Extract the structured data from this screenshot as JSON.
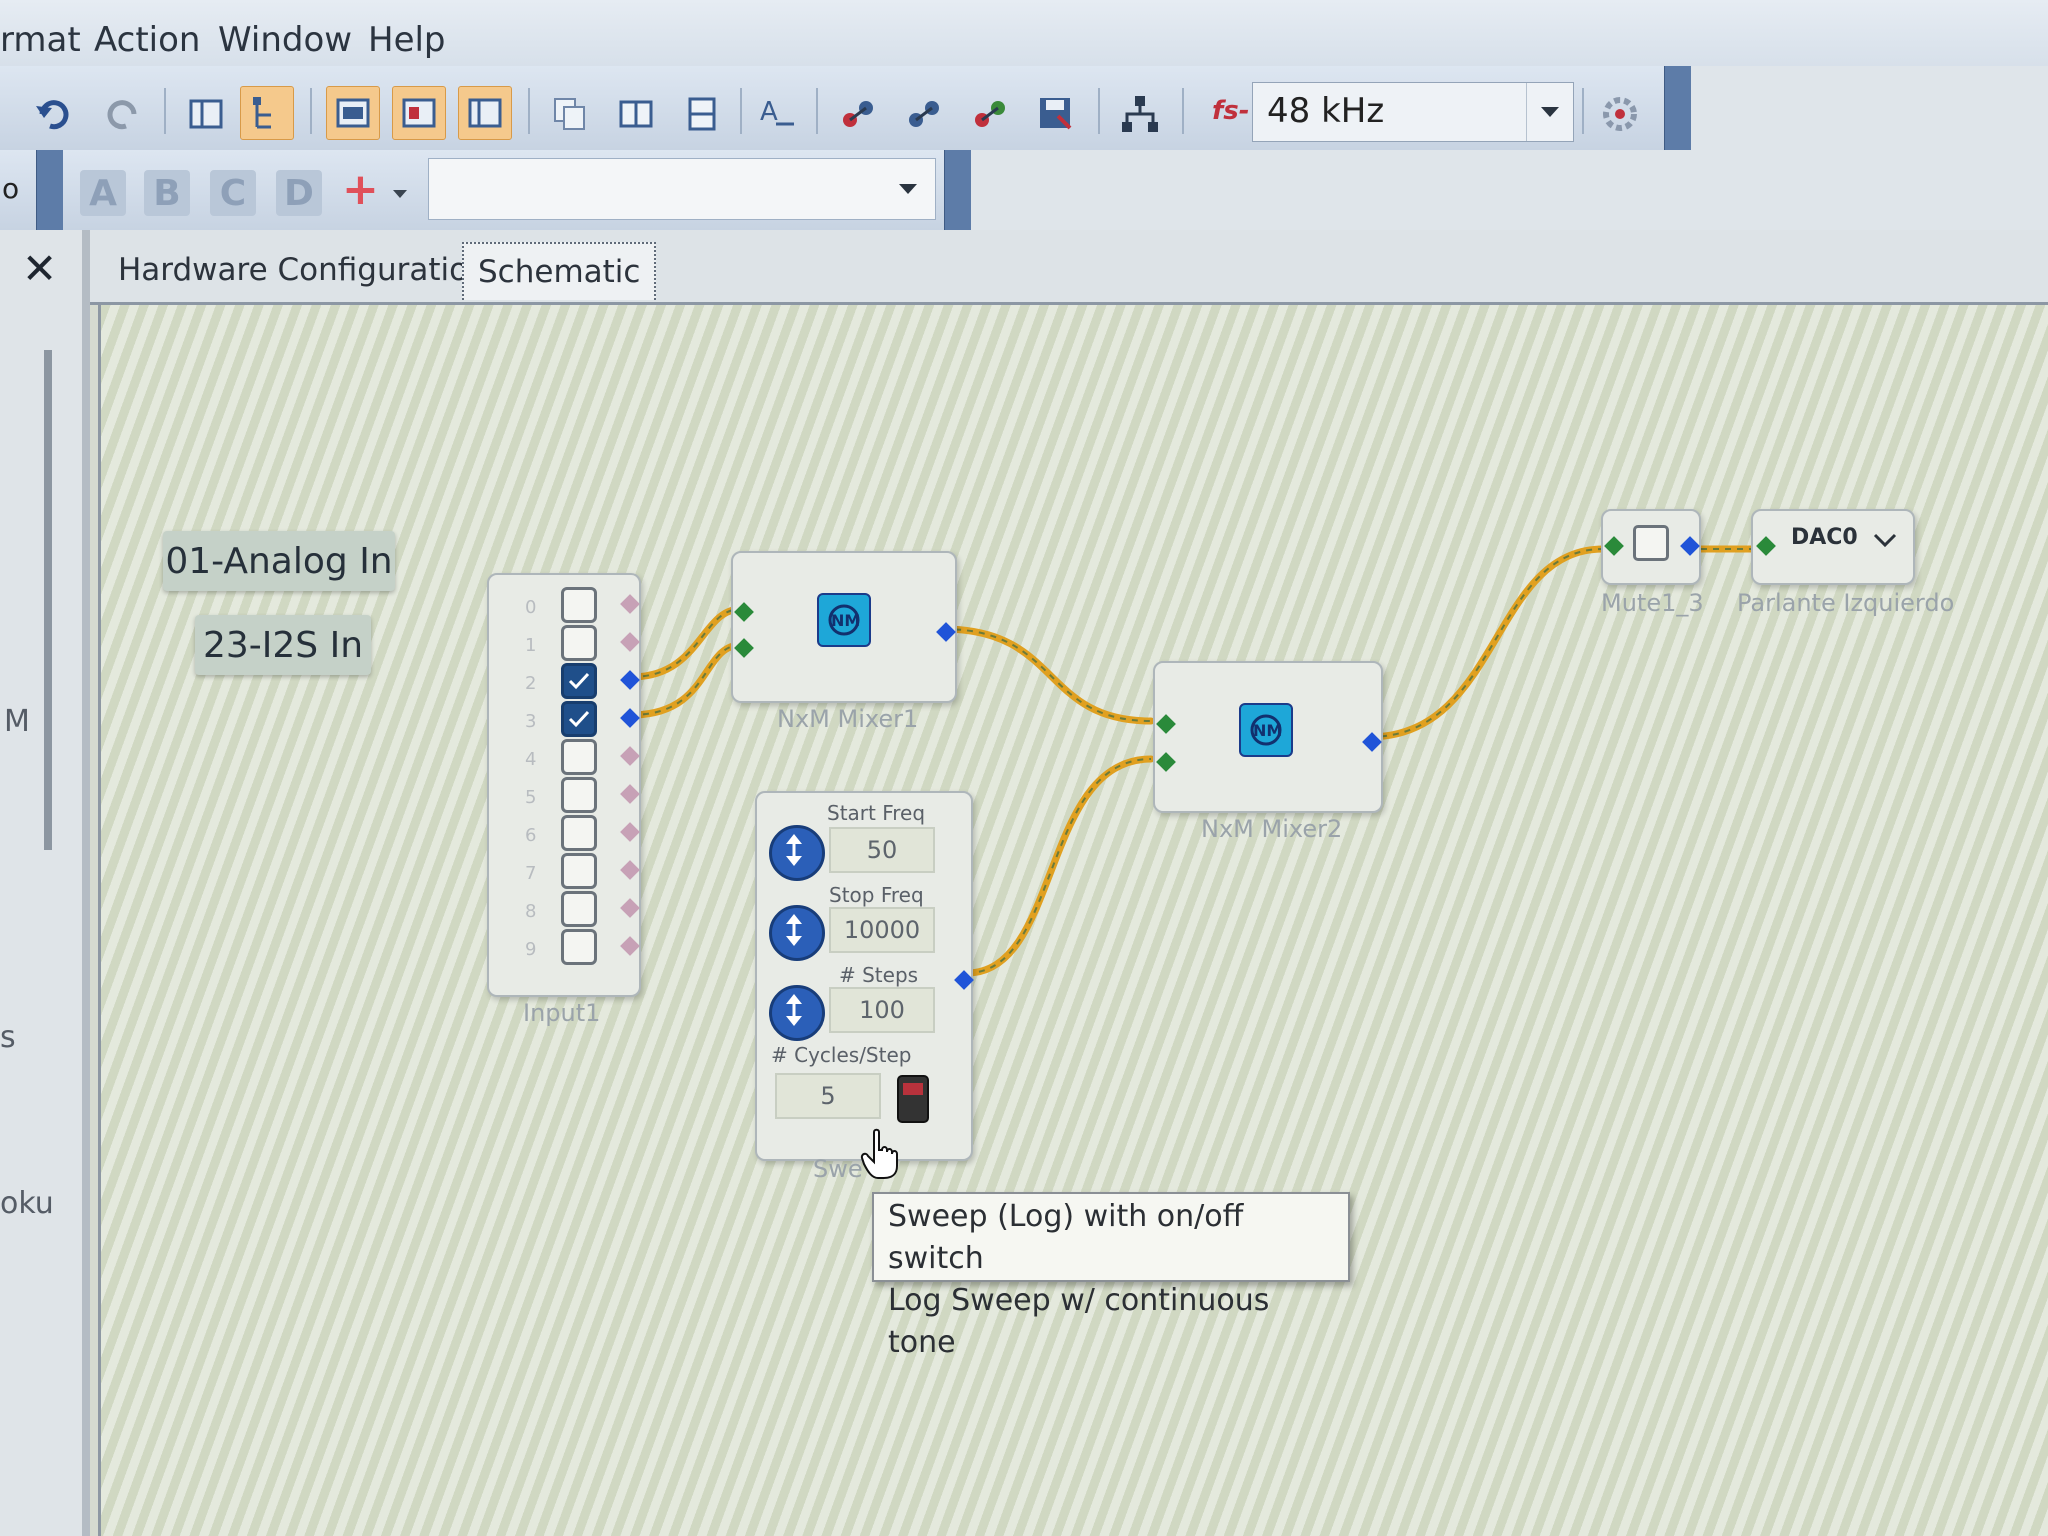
{
  "menu": {
    "items": [
      "rmat",
      "Action",
      "Window",
      "Help"
    ]
  },
  "toolbar": {
    "sample_rate_prefix": "fs-",
    "sample_rate": "48 kHz",
    "letter_buttons": [
      "A",
      "B",
      "C",
      "D"
    ],
    "add_symbol": "+",
    "left_stub": "o"
  },
  "tabs": [
    {
      "label": "Hardware Configuration",
      "active": false
    },
    {
      "label": "Schematic",
      "active": true
    }
  ],
  "side_panel": {
    "close": "✕",
    "fragments": [
      "M",
      "s",
      "oku"
    ]
  },
  "schematic": {
    "labels": {
      "analog_in": "01-Analog In",
      "i2s_in": "23-I2S In"
    },
    "input": {
      "caption": "Input1",
      "channels": [
        {
          "num": "0",
          "checked": false
        },
        {
          "num": "1",
          "checked": false
        },
        {
          "num": "2",
          "checked": true
        },
        {
          "num": "3",
          "checked": true
        },
        {
          "num": "4",
          "checked": false
        },
        {
          "num": "5",
          "checked": false
        },
        {
          "num": "6",
          "checked": false
        },
        {
          "num": "7",
          "checked": false
        },
        {
          "num": "8",
          "checked": false
        },
        {
          "num": "9",
          "checked": false
        }
      ]
    },
    "mixer1": {
      "caption": "NxM Mixer1"
    },
    "mixer2": {
      "caption": "NxM Mixer2"
    },
    "sweep": {
      "caption": "Swe",
      "start_freq_label": "Start Freq",
      "start_freq": "50",
      "stop_freq_label": "Stop Freq",
      "stop_freq": "10000",
      "steps_label": "# Steps",
      "steps": "100",
      "cycles_label": "# Cycles/Step",
      "cycles": "5"
    },
    "mute": {
      "caption": "Mute1_3"
    },
    "dac": {
      "value": "DAC0",
      "caption": "Parlante Izquierdo"
    }
  },
  "tooltip": {
    "line1": "Sweep (Log) with on/off switch",
    "line2": "Log Sweep w/ continuous tone"
  },
  "colors": {
    "wire": "#e0a020",
    "pin_green": "#2a8a3a",
    "pin_blue": "#2054d8",
    "checked_box": "#1f4f8a"
  }
}
